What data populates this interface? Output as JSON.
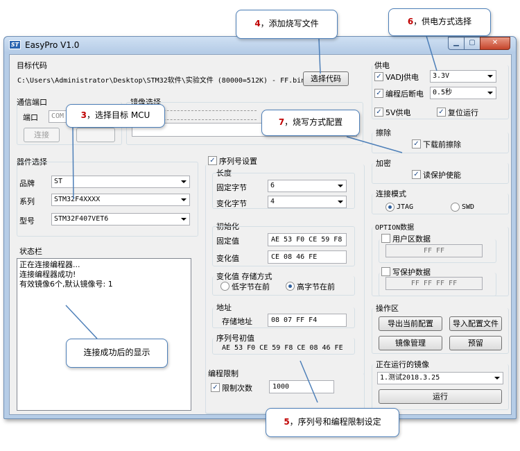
{
  "window": {
    "title": "EasyPro V1.0",
    "icon": "app-icon"
  },
  "target_code": {
    "title": "目标代码",
    "path": "C:\\Users\\Administrator\\Desktop\\STM32软件\\实验文件 (80000=512K) - FF.bin",
    "select_button": "选择代码"
  },
  "comm_port": {
    "title": "通信端口",
    "port_label": "端口",
    "port_value": "COM",
    "connect_button": "连接"
  },
  "image_select": {
    "title": "镜像选择"
  },
  "device": {
    "title": "器件选择",
    "brand_label": "品牌",
    "brand_value": "ST",
    "series_label": "系列",
    "series_value": "STM32F4XXXX",
    "model_label": "型号",
    "model_value": "STM32F407VET6"
  },
  "status_bar": {
    "title": "状态栏",
    "lines": "正在连接编程器...\n连接编程器成功!\n有效镜像6个,默认镜像号: 1"
  },
  "serial": {
    "enable_label": "序列号设置",
    "length_title": "长度",
    "fixed_bytes_label": "固定字节",
    "fixed_bytes_value": "6",
    "var_bytes_label": "变化字节",
    "var_bytes_value": "4",
    "init_title": "初始化",
    "fixed_value_label": "固定值",
    "fixed_value": "AE 53 F0 CE 59 F8",
    "var_value_label": "变化值",
    "var_value": "CE 08 46 FE",
    "storage_title": "变化值 存储方式",
    "low_first": "低字节在前",
    "high_first": "高字节在前",
    "addr_title": "地址",
    "storage_addr_label": "存储地址",
    "storage_addr_value": "08 07 FF F4",
    "initial_title": "序列号初值",
    "initial_value": "AE 53 F0 CE 59 F8 CE 08 46 FE"
  },
  "prog_limit": {
    "title": "编程限制",
    "limit_label": "限制次数",
    "limit_value": "1000"
  },
  "power": {
    "title": "供电",
    "vadj_label": "VADJ供电",
    "vadj_value": "3.3V",
    "disconnect_label": "编程后断电",
    "disconnect_value": "0.5秒",
    "v5_label": "5V供电",
    "reset_label": "复位运行"
  },
  "erase": {
    "title": "擦除",
    "erase_label": "下载前擦除"
  },
  "encrypt": {
    "title": "加密",
    "read_protect_label": "读保护使能"
  },
  "connect_mode": {
    "title": "连接模式",
    "jtag": "JTAG",
    "swd": "SWD"
  },
  "option_data": {
    "title": "OPTION数据",
    "user_label": "用户区数据",
    "user_value": "FF FF",
    "write_protect_label": "写保护数据",
    "write_protect_value": "FF FF FF FF"
  },
  "operations": {
    "title": "操作区",
    "export_button": "导出当前配置",
    "import_button": "导入配置文件",
    "image_manage_button": "镜像管理",
    "reserve_button": "预留"
  },
  "running_image": {
    "title": "正在运行的镜像",
    "value": "1.测试2018.3.25",
    "run_button": "运行"
  },
  "callouts": {
    "c3_num": "3",
    "c3_text": "，选择目标 MCU",
    "c4_num": "4",
    "c4_text": "，添加烧写文件",
    "c5_num": "5",
    "c5_text": "，序列号和编程限制设定",
    "c6_num": "6",
    "c6_text": "，供电方式选择",
    "c7_num": "7",
    "c7_text": "，烧写方式配置",
    "connected_text": "连接成功后的显示"
  }
}
